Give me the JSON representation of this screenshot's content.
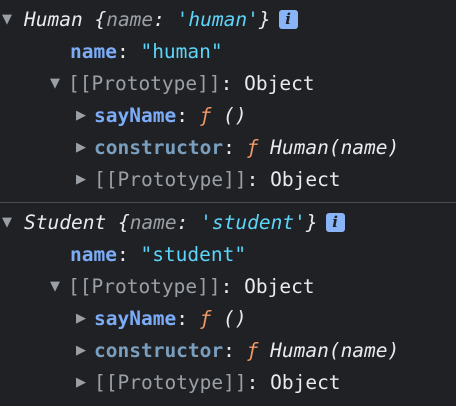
{
  "entries": [
    {
      "class_name": "Human",
      "preview_open": "{",
      "preview_key": "name",
      "preview_sep": ": ",
      "preview_value": "'human'",
      "preview_close": "}",
      "info_icon": "i",
      "name_key": "name",
      "name_sep": ": ",
      "name_value": "\"human\"",
      "proto_label": "[[Prototype]]",
      "proto_sep": ": ",
      "proto_value": "Object",
      "say_name_key": "sayName",
      "say_name_sep": ": ",
      "say_name_f": "ƒ",
      "say_name_sig": "()",
      "ctor_key": "constructor",
      "ctor_sep": ": ",
      "ctor_f": "ƒ",
      "ctor_sig": "Human(name)",
      "inner_proto_label": "[[Prototype]]",
      "inner_proto_sep": ": ",
      "inner_proto_value": "Object"
    },
    {
      "class_name": "Student",
      "preview_open": "{",
      "preview_key": "name",
      "preview_sep": ": ",
      "preview_value": "'student'",
      "preview_close": "}",
      "info_icon": "i",
      "name_key": "name",
      "name_sep": ": ",
      "name_value": "\"student\"",
      "proto_label": "[[Prototype]]",
      "proto_sep": ": ",
      "proto_value": "Object",
      "say_name_key": "sayName",
      "say_name_sep": ": ",
      "say_name_f": "ƒ",
      "say_name_sig": "()",
      "ctor_key": "constructor",
      "ctor_sep": ": ",
      "ctor_f": "ƒ",
      "ctor_sig": "Human(name)",
      "inner_proto_label": "[[Prototype]]",
      "inner_proto_sep": ": ",
      "inner_proto_value": "Object"
    }
  ],
  "icons": {
    "expanded": "▼",
    "collapsed": "▶"
  }
}
